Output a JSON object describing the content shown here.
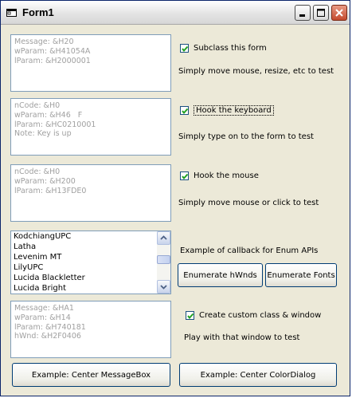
{
  "window": {
    "title": "Form1",
    "icon": "form-window-icon"
  },
  "titlebar_buttons": {
    "minimize": "minimize-icon",
    "maximize": "maximize-icon",
    "close": "close-icon"
  },
  "subclass": {
    "text": "Message: &H20\nwParam: &H41054A\nlParam: &H2000001",
    "check_label": "Subclass this form",
    "checked": true,
    "hint": "Simply move mouse, resize, etc to test"
  },
  "keyboard": {
    "text": "nCode: &H0\nwParam: &H46   F\nlParam: &HC0210001\nNote: Key is up",
    "check_label": "Hook the keyboard",
    "checked": true,
    "hint": "Simply type on to the form to test"
  },
  "mouse": {
    "text": "nCode: &H0\nwParam: &H200\nlParam: &H13FDE0",
    "check_label": "Hook the mouse",
    "checked": true,
    "hint": "Simply move mouse or click to test"
  },
  "enum": {
    "fonts": [
      "KodchiangUPC",
      "Latha",
      "Levenim MT",
      "LilyUPC",
      "Lucida Blackletter",
      "Lucida Bright"
    ],
    "hint": "Example of callback for Enum APIs",
    "hwnds_button": "Enumerate hWnds",
    "fonts_button": "Enumerate Fonts"
  },
  "custom": {
    "text": "Message: &HA1\nwParam: &H14\nlParam: &H740181\nhWnd: &H2F0406",
    "check_label": "Create custom class & window",
    "checked": true,
    "hint": "Play with that window to test"
  },
  "buttons": {
    "center_messagebox": "Example: Center MessageBox",
    "center_colordialog": "Example: Center ColorDialog"
  }
}
